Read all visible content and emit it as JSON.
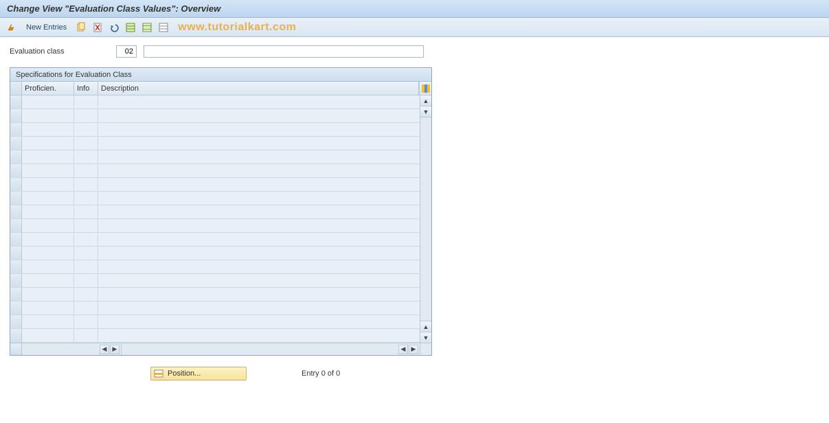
{
  "title": "Change View \"Evaluation Class Values\": Overview",
  "toolbar": {
    "new_entries": "New Entries"
  },
  "watermark": "www.tutorialkart.com",
  "fields": {
    "eval_class_label": "Evaluation class",
    "eval_class_value": "02",
    "eval_class_desc": ""
  },
  "panel": {
    "title": "Specifications for Evaluation Class",
    "columns": {
      "proficien": "Proficien.",
      "info": "Info",
      "description": "Description"
    },
    "rows": []
  },
  "footer": {
    "position_label": "Position...",
    "entry_text": "Entry 0 of 0"
  }
}
